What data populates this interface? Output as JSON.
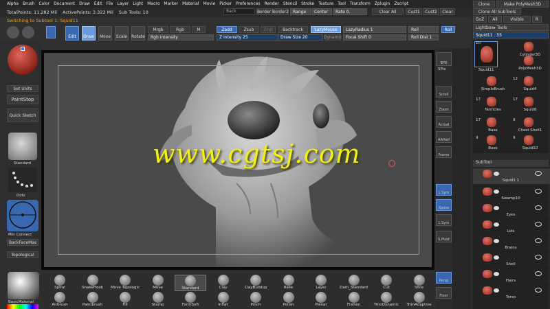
{
  "menu": [
    "Alpha",
    "Brush",
    "Color",
    "Document",
    "Draw",
    "Edit",
    "File",
    "Layer",
    "Light",
    "Macro",
    "Marker",
    "Material",
    "Movie",
    "Picker",
    "Preferences",
    "Render",
    "Stencil",
    "Stroke",
    "Texture",
    "Tool",
    "Transform",
    "Zplugin",
    "Zscript"
  ],
  "info": {
    "total_points": "TotalPoints: 11.282 Mil",
    "active_points": "ActivePoints: 3.323 Mil",
    "sub_tools": "Sub Tools: 10",
    "back_field": "Back",
    "border_label": "Border",
    "border2_label": "Border2",
    "range_label": "Range",
    "center_label": "Center",
    "rate_label": "Rate 0.",
    "clear_all": "Clear All",
    "cust1": "Cust1",
    "cust2": "Cust2",
    "clear": "Clear"
  },
  "switching": "Switching to Subtool 1:  Squid11",
  "toolbar": {
    "edit": "Edit",
    "draw": "Draw",
    "move": "Move",
    "scale": "Scale",
    "rotate": "Rotate",
    "mrgb": "Mrgb",
    "rgb": "Rgb",
    "m": "M",
    "rgb_intensity": "Rgb Intensity",
    "zadd": "Zadd",
    "zsub": "Zsub",
    "zcut": "Zcut",
    "z_intensity": "Z Intensity 25",
    "backtrack": "Backtrack",
    "lazymouse": "LazyMouse",
    "lazyradius": "LazyRadius 1",
    "draw_size": "Draw Size 20",
    "dynamic": "Dynamic",
    "lazystep": "LazyStep 0.",
    "focal_shift": "Focal Shift 0",
    "roll": "Roll",
    "roll_dist": "Roll Dist 1",
    "roll2": "Roll"
  },
  "left": {
    "set_units": "Set Units",
    "paintstop": "PaintStop",
    "quick_sketch": "Quick Sketch",
    "standard": "Standard",
    "dots": "Dots",
    "min_connect": "Min Connect",
    "backface": "BackFaceMas",
    "topological": "Topological",
    "basic_material": "BasicMaterial"
  },
  "shelf": {
    "bpr": "BPR",
    "spix": "SPix",
    "scroll": "Scroll",
    "zoom": "Zoom",
    "actual": "Actual",
    "aahalf": "AAHalf",
    "frame": "Frame",
    "lsym": "L.Sym",
    "xpose": "Xpose",
    "lsym2": "L.Sym",
    "spivot": "S.Pivot",
    "persp": "Persp",
    "floor": "Floor"
  },
  "brushes_top": [
    "Spiral",
    "SnakeHook",
    "Move Topologic",
    "Move",
    "Standard",
    "Clay",
    "ClayBuildup",
    "Rake",
    "Layer",
    "Dam_Standard",
    "Cut",
    "Slice"
  ],
  "brushes_bottom": [
    "Airbrush",
    "Paintbrush",
    "Fill",
    "Stamp",
    "FormSoft",
    "Inflat",
    "Pinch",
    "Polish",
    "Planar",
    "Flatten",
    "TrimDynamic",
    "TrimAdaptive"
  ],
  "right": {
    "clone": "Clone",
    "make_polymesh": "Make PolyMesh3D",
    "clone_all": "Clone All SubTools",
    "goz": "GoZ",
    "all": "All",
    "visible": "Visible",
    "r": "R",
    "lightbox_tools": "Lightbox▸ Tools",
    "squid_slider": "Squid11 . 55",
    "tool_count": "10",
    "squid_label": "Squid11",
    "tools": [
      {
        "name": "Cylinder3D",
        "count": ""
      },
      {
        "name": "PolyMesh3D",
        "count": ""
      },
      {
        "name": "SimpleBrush",
        "count": ""
      },
      {
        "name": "Squid4",
        "count": "12"
      },
      {
        "name": "Tenticles",
        "count": "17"
      },
      {
        "name": "Squid6",
        "count": "17"
      },
      {
        "name": "Base",
        "count": "17"
      },
      {
        "name": "Chest Shell1",
        "count": "9"
      },
      {
        "name": "Base",
        "count": "9"
      },
      {
        "name": "Squid10",
        "count": "9"
      }
    ],
    "subtool_header": "SubTool",
    "subtools": [
      "Squid1 1",
      "Swamp10",
      "Eyes",
      "Lids",
      "Brains",
      "Shell",
      "Hairs",
      "Torso"
    ]
  },
  "watermark": "www.cgtsj.com"
}
